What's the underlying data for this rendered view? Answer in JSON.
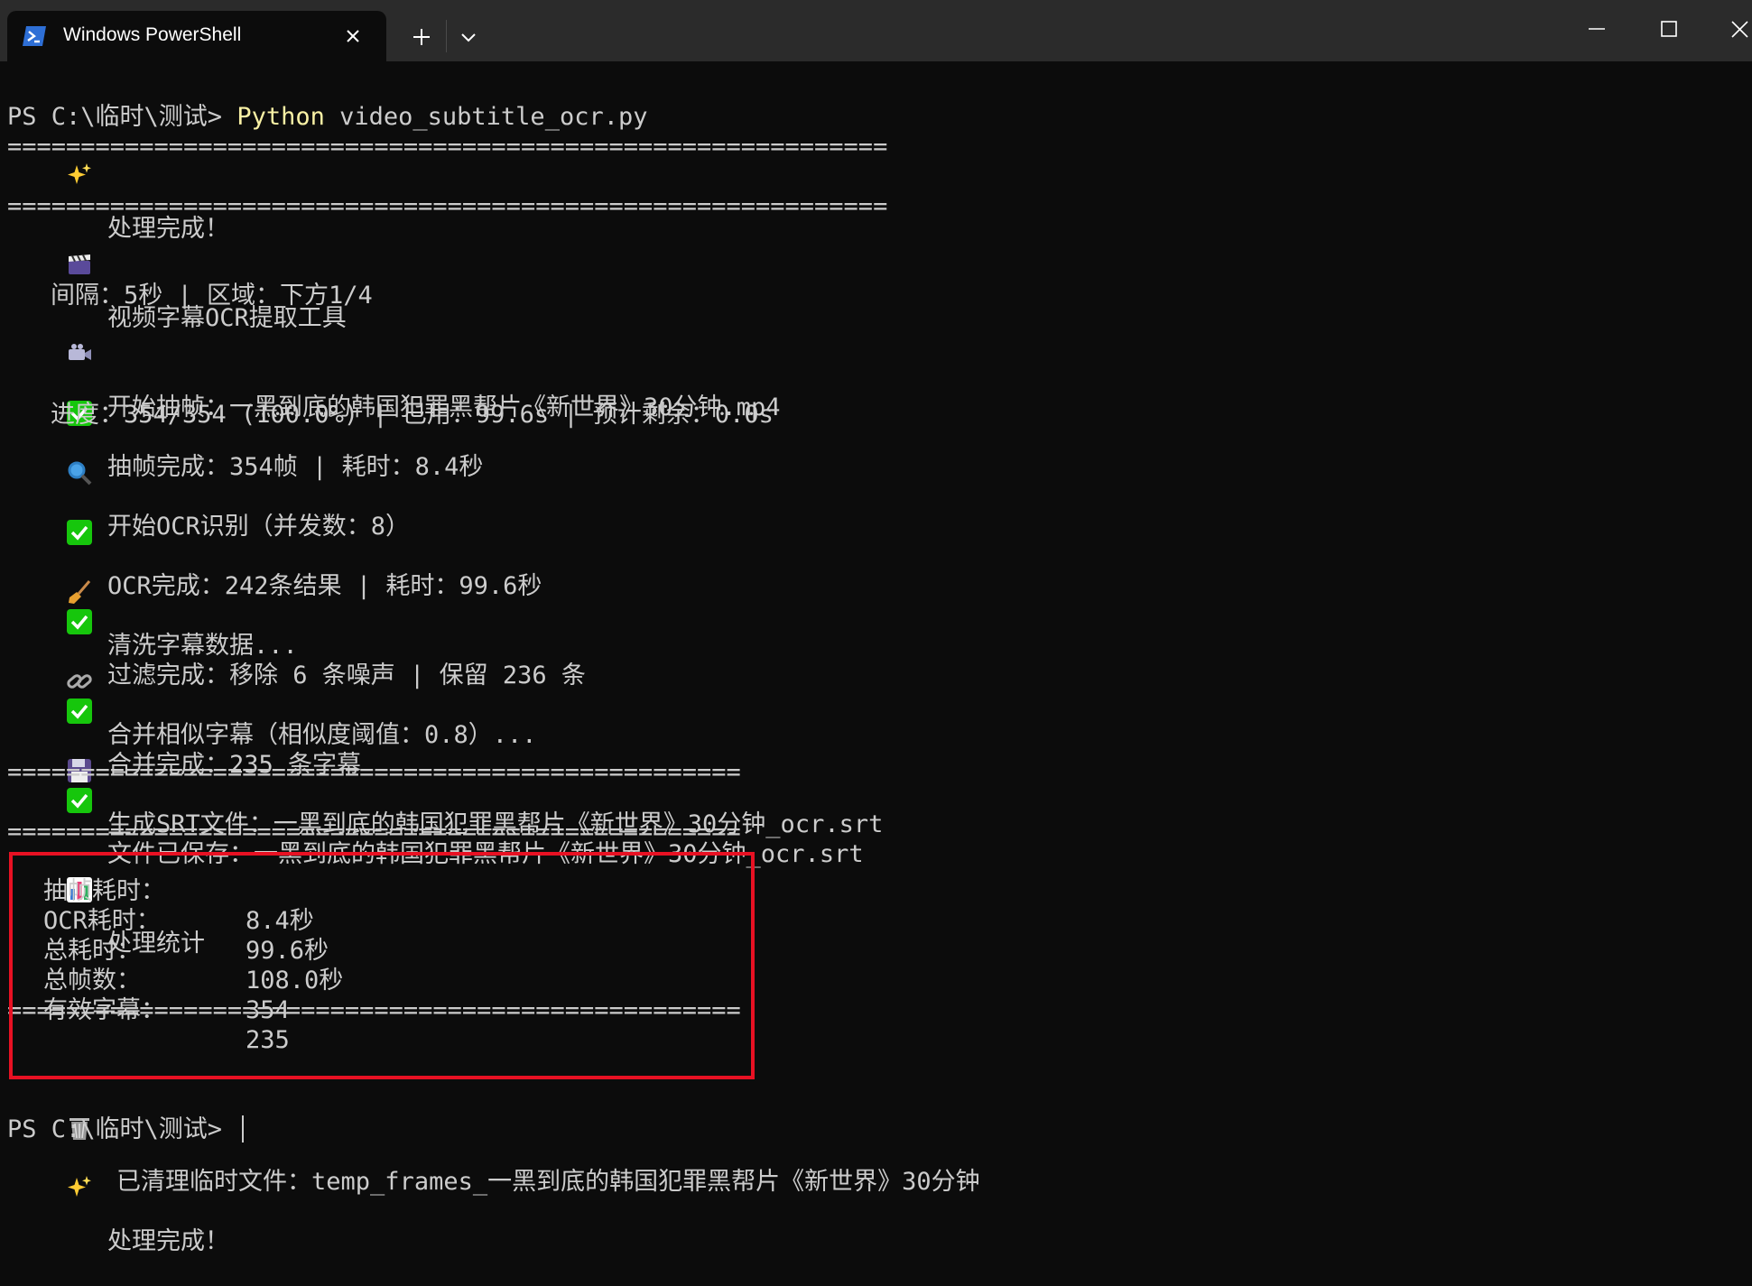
{
  "window": {
    "tab_title": "Windows PowerShell",
    "tab_icon": "powershell-icon",
    "close_tab_icon": "close-icon",
    "new_tab_icon": "plus-icon",
    "dropdown_icon": "chevron-down-icon",
    "minimize_icon": "minimize-icon",
    "maximize_icon": "maximize-icon",
    "close_window_icon": "close-icon"
  },
  "colors": {
    "background": "#0c0c0c",
    "text": "#cccccc",
    "command_highlight": "#f9f1a5",
    "highlight_box": "#e81123",
    "titlebar": "#2b2b2b"
  },
  "terminal": {
    "line_done_prev": "处理完成！",
    "prompt1": "PS C:\\临时\\测试> ",
    "cmd_keyword": "Python",
    "cmd_args": " video_subtitle_ocr.py",
    "rule_long_1": "============================================================",
    "header_title": "视频字幕OCR提取工具",
    "rule_long_2": "============================================================",
    "extract_start": "开始抽帧：一黑到底的韩国犯罪黑帮片《新世界》30分钟.mp4",
    "extract_params": "间隔：5秒 | 区域：下方1/4",
    "extract_done": "抽帧完成：354帧 | 耗时：8.4秒",
    "ocr_start": "开始OCR识别（并发数：8）",
    "ocr_progress": "进度：354/354 (100.0%) | 已用：99.6s | 预计剩余：0.0s",
    "ocr_done": "OCR完成：242条结果 | 耗时：99.6秒",
    "clean_start": "清洗字幕数据...",
    "clean_done": "过滤完成：移除 6 条噪声 | 保留 236 条",
    "merge_start": "合并相似字幕（相似度阈值：0.8）...",
    "merge_done": "合并完成：235 条字幕",
    "srt_start": "生成SRT文件：一黑到底的韩国犯罪黑帮片《新世界》30分钟_ocr.srt",
    "srt_saved": "文件已保存：一黑到底的韩国犯罪黑帮片《新世界》30分钟_ocr.srt",
    "rule_short_1": "==================================================",
    "stats_title": "处理统计",
    "rule_short_2": "==================================================",
    "rule_short_3": "==================================================",
    "cleanup": "已清理临时文件：temp_frames_一黑到底的韩国犯罪黑帮片《新世界》30分钟",
    "final_done": "处理完成！",
    "prompt2": "PS C:\\临时\\测试> "
  },
  "stats": [
    {
      "label": "抽帧耗时：",
      "value": "8.4秒"
    },
    {
      "label": "OCR耗时：",
      "value": "99.6秒"
    },
    {
      "label": "总耗时：",
      "value": "108.0秒"
    },
    {
      "label": "总帧数：",
      "value": "354"
    },
    {
      "label": "有效字幕：",
      "value": "235"
    }
  ],
  "line_icons": {
    "sparkles": "sparkles-icon",
    "clapper": "clapper-board-icon",
    "camera": "video-camera-icon",
    "check": "check-mark-icon",
    "magnifier": "magnifying-glass-icon",
    "broom": "broom-icon",
    "link": "link-icon",
    "floppy": "floppy-disk-icon",
    "chart": "bar-chart-icon",
    "trash": "wastebasket-icon"
  }
}
